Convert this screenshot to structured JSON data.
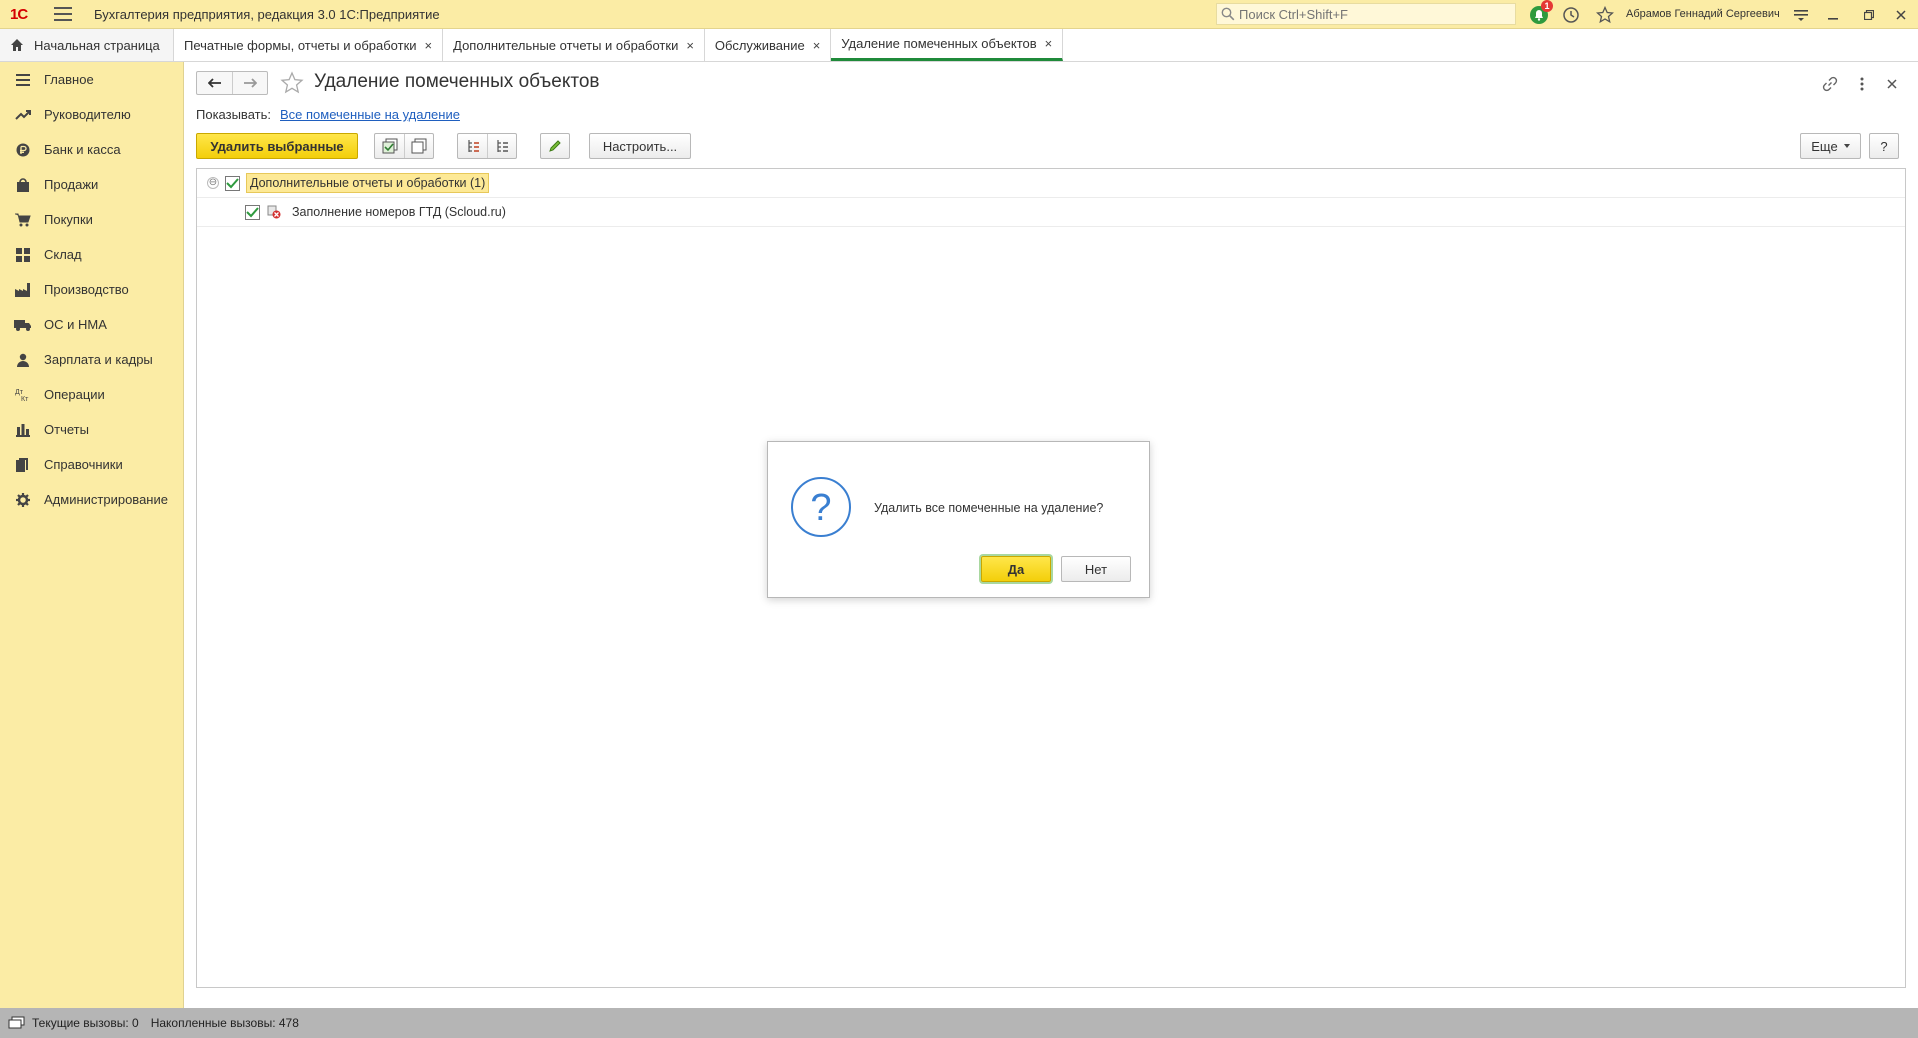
{
  "app": {
    "logo_text": "1С",
    "title": "Бухгалтерия предприятия, редакция 3.0 1С:Предприятие",
    "search_placeholder": "Поиск Ctrl+Shift+F",
    "notification_count": "1",
    "user_name": "Абрамов Геннадий Сергеевич"
  },
  "tabs": {
    "home_label": "Начальная страница",
    "items": [
      {
        "label": "Печатные формы, отчеты и обработки",
        "close": "×"
      },
      {
        "label": "Дополнительные отчеты и обработки",
        "close": "×"
      },
      {
        "label": "Обслуживание",
        "close": "×"
      },
      {
        "label": "Удаление помеченных объектов",
        "close": "×"
      }
    ]
  },
  "sidebar": {
    "items": [
      {
        "label": "Главное",
        "icon": "menu-icon"
      },
      {
        "label": "Руководителю",
        "icon": "trend-icon"
      },
      {
        "label": "Банк и касса",
        "icon": "ruble-icon"
      },
      {
        "label": "Продажи",
        "icon": "bag-icon"
      },
      {
        "label": "Покупки",
        "icon": "cart-icon"
      },
      {
        "label": "Склад",
        "icon": "grid-icon"
      },
      {
        "label": "Производство",
        "icon": "factory-icon"
      },
      {
        "label": "ОС и НМА",
        "icon": "truck-icon"
      },
      {
        "label": "Зарплата и кадры",
        "icon": "person-icon"
      },
      {
        "label": "Операции",
        "icon": "dt-kt-icon"
      },
      {
        "label": "Отчеты",
        "icon": "bar-chart-icon"
      },
      {
        "label": "Справочники",
        "icon": "books-icon"
      },
      {
        "label": "Администрирование",
        "icon": "gear-icon"
      }
    ]
  },
  "form": {
    "title": "Удаление помеченных объектов",
    "show_label": "Показывать:",
    "show_link": "Все помеченные на удаление",
    "delete_selected_label": "Удалить выбранные",
    "configure_label": "Настроить...",
    "more_label": "Еще",
    "help_label": "?"
  },
  "tree": {
    "group_label": "Дополнительные отчеты и обработки (1)",
    "collapse_symbol": "⊖",
    "item_label": "Заполнение номеров ГТД (Scloud.ru)"
  },
  "dialog": {
    "question_mark": "?",
    "message": "Удалить все помеченные на удаление?",
    "yes_label": "Да",
    "no_label": "Нет"
  },
  "status": {
    "current_calls": "Текущие вызовы: 0",
    "accumulated_calls": "Накопленные вызовы: 478"
  },
  "colors": {
    "panel_yellow": "#fbeca5",
    "primary_button": "#f3cf0a",
    "link_blue": "#1f5fbf",
    "active_tab_green": "#1f8a3a",
    "dialog_icon_blue": "#3a7fd1",
    "status_gray": "#b5b5b5"
  }
}
